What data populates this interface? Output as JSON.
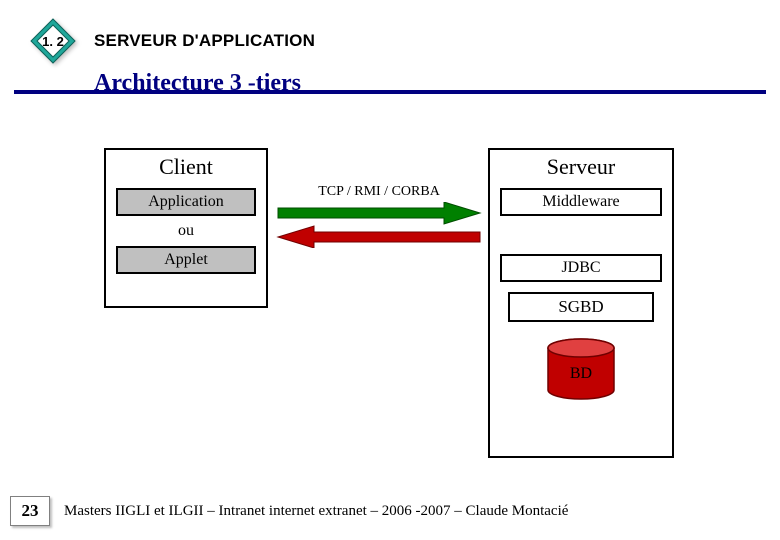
{
  "header": {
    "section_number": "1. 2",
    "section_label": "SERVEUR D'APPLICATION",
    "title": "Architecture 3 -tiers"
  },
  "diagram": {
    "client": {
      "title": "Client",
      "items": [
        "Application",
        "Applet"
      ],
      "sep": "ou"
    },
    "server": {
      "title": "Serveur",
      "items": [
        "Middleware",
        "JDBC"
      ],
      "sgbd": "SGBD",
      "db": "BD"
    },
    "protocol": "TCP / RMI / CORBA"
  },
  "footer": {
    "page": "23",
    "text": "Masters IIGLI et ILGII – Intranet internet extranet – 2006 -2007 – Claude Montacié"
  },
  "colors": {
    "navy": "#000080",
    "teal": "#1fa79a",
    "red": "#c00000",
    "green": "#008000"
  }
}
